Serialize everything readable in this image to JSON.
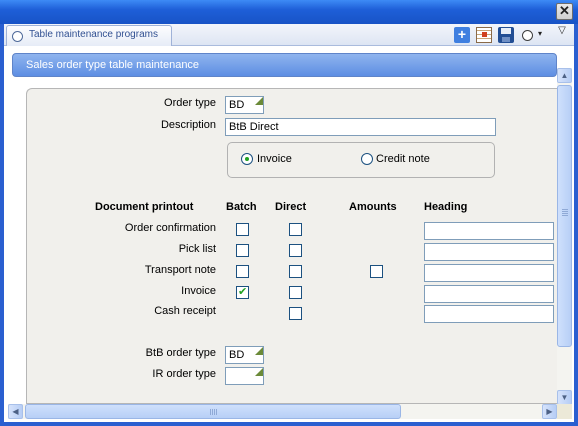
{
  "window": {
    "tab_label": "Table maintenance programs",
    "close_glyph": "✕",
    "menu_glyph": "▽",
    "caret_glyph": "▾"
  },
  "header": {
    "title": "Sales order type table maintenance"
  },
  "form": {
    "order_type": {
      "label": "Order type",
      "value": "BD"
    },
    "description": {
      "label": "Description",
      "value": "BtB Direct"
    },
    "invoice_radio": {
      "label": "Invoice",
      "selected": true
    },
    "credit_note_radio": {
      "label": "Credit note",
      "selected": false
    },
    "columns": {
      "document_printout": "Document printout",
      "batch": "Batch",
      "direct": "Direct",
      "amounts": "Amounts",
      "heading": "Heading"
    },
    "rows": [
      {
        "label": "Order confirmation",
        "batch": false,
        "direct": false,
        "heading": ""
      },
      {
        "label": "Pick list",
        "batch": false,
        "direct": false,
        "heading": ""
      },
      {
        "label": "Transport note",
        "batch": false,
        "direct": false,
        "amounts": false,
        "heading": ""
      },
      {
        "label": "Invoice",
        "batch": true,
        "direct": false,
        "heading": ""
      },
      {
        "label": "Cash receipt",
        "direct": false,
        "heading": ""
      }
    ],
    "btb_order_type": {
      "label": "BtB order type",
      "value": "BD"
    },
    "ir_order_type": {
      "label": "IR order type",
      "value": ""
    }
  },
  "colors": {
    "titlebar": "#1e5fd8",
    "header_bar": "#6b97e6",
    "check_green": "#21a121",
    "panel": "#f1f0ec"
  }
}
